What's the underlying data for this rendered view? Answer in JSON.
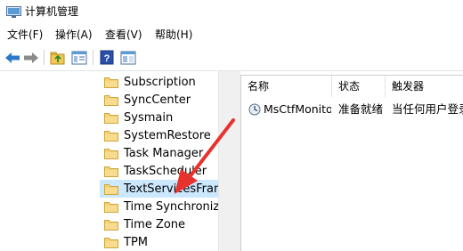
{
  "window": {
    "title": "计算机管理"
  },
  "menu": [
    "文件(F)",
    "操作(A)",
    "查看(V)",
    "帮助(H)"
  ],
  "toolbar": {
    "buttons": [
      "back-arrow-icon",
      "forward-arrow-icon",
      "up-folder-icon",
      "show-tree-icon",
      "help-icon",
      "properties-icon"
    ]
  },
  "tree": {
    "items": [
      {
        "label": "Subscription",
        "selected": false
      },
      {
        "label": "SyncCenter",
        "selected": false
      },
      {
        "label": "Sysmain",
        "selected": false
      },
      {
        "label": "SystemRestore",
        "selected": false
      },
      {
        "label": "Task Manager",
        "selected": false
      },
      {
        "label": "TaskScheduler",
        "selected": false
      },
      {
        "label": "TextServicesFramework",
        "selected": true
      },
      {
        "label": "Time Synchronization",
        "selected": false
      },
      {
        "label": "Time Zone",
        "selected": false
      },
      {
        "label": "TPM",
        "selected": false
      }
    ]
  },
  "list": {
    "headers": [
      "名称",
      "状态",
      "触发器"
    ],
    "rows": [
      {
        "name": "MsCtfMonitor",
        "status": "准备就绪",
        "trigger": "当任何用户登录时"
      }
    ]
  },
  "colors": {
    "selection": "#cce8ff",
    "arrow": "#e8322e",
    "folder": "#f4d27a"
  }
}
